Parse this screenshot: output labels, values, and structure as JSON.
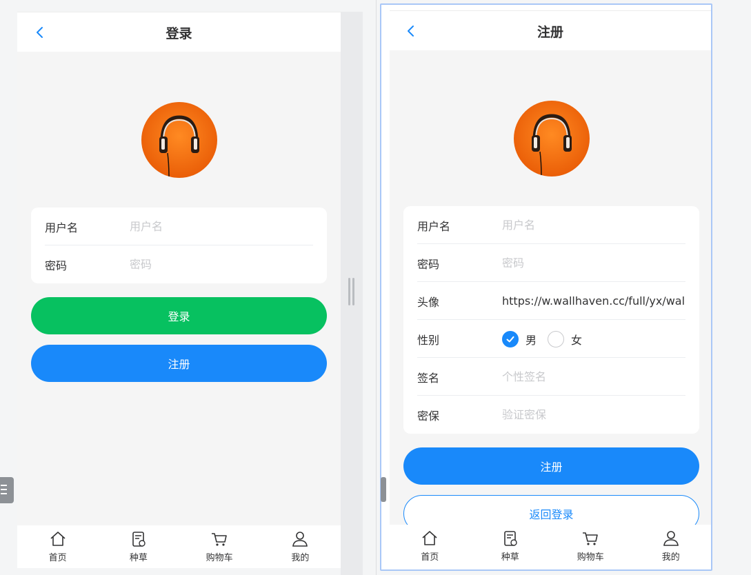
{
  "login": {
    "title": "登录",
    "fields": [
      {
        "label": "用户名",
        "placeholder": "用户名",
        "value": ""
      },
      {
        "label": "密码",
        "placeholder": "密码",
        "value": ""
      }
    ],
    "login_button": "登录",
    "register_button": "注册"
  },
  "register": {
    "title": "注册",
    "fields": {
      "username": {
        "label": "用户名",
        "placeholder": "用户名",
        "value": ""
      },
      "password": {
        "label": "密码",
        "placeholder": "密码",
        "value": ""
      },
      "avatar": {
        "label": "头像",
        "value": "https://w.wallhaven.cc/full/yx/wallhaven"
      },
      "gender": {
        "label": "性别",
        "options": [
          "男",
          "女"
        ],
        "selected": "男"
      },
      "signature": {
        "label": "签名",
        "placeholder": "个性签名",
        "value": ""
      },
      "security": {
        "label": "密保",
        "placeholder": "验证密保",
        "value": ""
      }
    },
    "register_button": "注册",
    "back_button": "返回登录"
  },
  "tabbar": {
    "items": [
      {
        "label": "首页",
        "icon": "home-icon"
      },
      {
        "label": "种草",
        "icon": "notes-icon"
      },
      {
        "label": "购物车",
        "icon": "cart-icon"
      },
      {
        "label": "我的",
        "icon": "user-icon"
      }
    ]
  },
  "colors": {
    "primary": "#1989fa",
    "success": "#07c160",
    "avatar_bg": "#f06a0f",
    "background": "#f5f5f5"
  }
}
